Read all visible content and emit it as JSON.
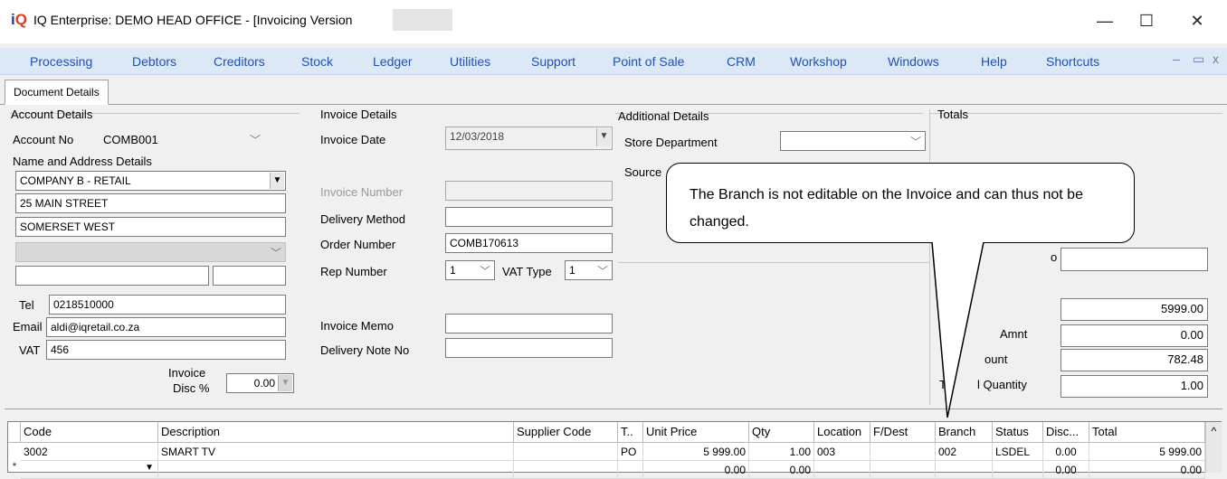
{
  "window": {
    "logo": "iQ",
    "title": "IQ Enterprise: DEMO HEAD OFFICE - [Invoicing Version",
    "minimize": "—",
    "maximize": "☐",
    "close": "✕"
  },
  "menu": {
    "items": [
      "Processing",
      "Debtors",
      "Creditors",
      "Stock",
      "Ledger",
      "Utilities",
      "Support",
      "Point of Sale",
      "CRM",
      "Workshop",
      "Windows",
      "Help",
      "Shortcuts"
    ],
    "controls": [
      "–",
      "▭",
      "x"
    ]
  },
  "tabs": [
    "Document Details"
  ],
  "account": {
    "group_label": "Account Details",
    "account_no_label": "Account No",
    "account_no": "COMB001",
    "name_addr_label": "Name and Address Details",
    "name": "COMPANY B - RETAIL",
    "address1": "25 MAIN STREET",
    "address2": "SOMERSET WEST",
    "address3": "",
    "postal_a": "",
    "postal_b": "",
    "tel_label": "Tel",
    "tel": "0218510000",
    "email_label": "Email",
    "email": "aldi@iqretail.co.za",
    "vat_label": "VAT",
    "vat": "456",
    "disc_label_1": "Invoice",
    "disc_label_2": "Disc %",
    "disc": "0.00"
  },
  "invoice": {
    "group_label": "Invoice Details",
    "date_label": "Invoice Date",
    "date": "12/03/2018",
    "number_label": "Invoice Number",
    "number": "",
    "delivery_label": "Delivery Method",
    "delivery": "",
    "order_label": "Order Number",
    "order": "COMB170613",
    "rep_label": "Rep Number",
    "rep": "1",
    "vat_type_label": "VAT Type",
    "vat_type": "1",
    "memo_label": "Invoice Memo",
    "memo": "",
    "delivery_note_label": "Delivery Note No",
    "delivery_note": ""
  },
  "additional": {
    "group_label": "Additional Details",
    "store_dept_label": "Store Department",
    "store_dept": "",
    "source_label": "Source"
  },
  "totals": {
    "group_label": "Totals",
    "partial_label_1": "o",
    "field_blank": "",
    "subtotal": "5999.00",
    "discount_label": "Amnt",
    "discount": "0.00",
    "vat_label": "ount",
    "vat_amount": "782.48",
    "qty_label": "l Quantity",
    "qty_prefix": "T",
    "qty": "1.00"
  },
  "callout": {
    "text": "The Branch is not editable on the Invoice and can thus not be changed."
  },
  "grid": {
    "columns": [
      "Code",
      "Description",
      "Supplier Code",
      "T..",
      "Unit Price",
      "Qty",
      "Location",
      "F/Dest",
      "Branch",
      "Status",
      "Disc...",
      "Total"
    ],
    "rows": [
      [
        "3002",
        "SMART TV",
        "",
        "PO",
        "5 999.00",
        "1.00",
        "003",
        "",
        "002",
        "LSDEL",
        "0.00",
        "5 999.00"
      ],
      [
        "",
        "",
        "",
        "",
        "0.00",
        "0.00",
        "",
        "",
        "",
        "",
        "0.00",
        "0.00"
      ]
    ],
    "new_row_marker": "*",
    "scroll_up": "^"
  }
}
